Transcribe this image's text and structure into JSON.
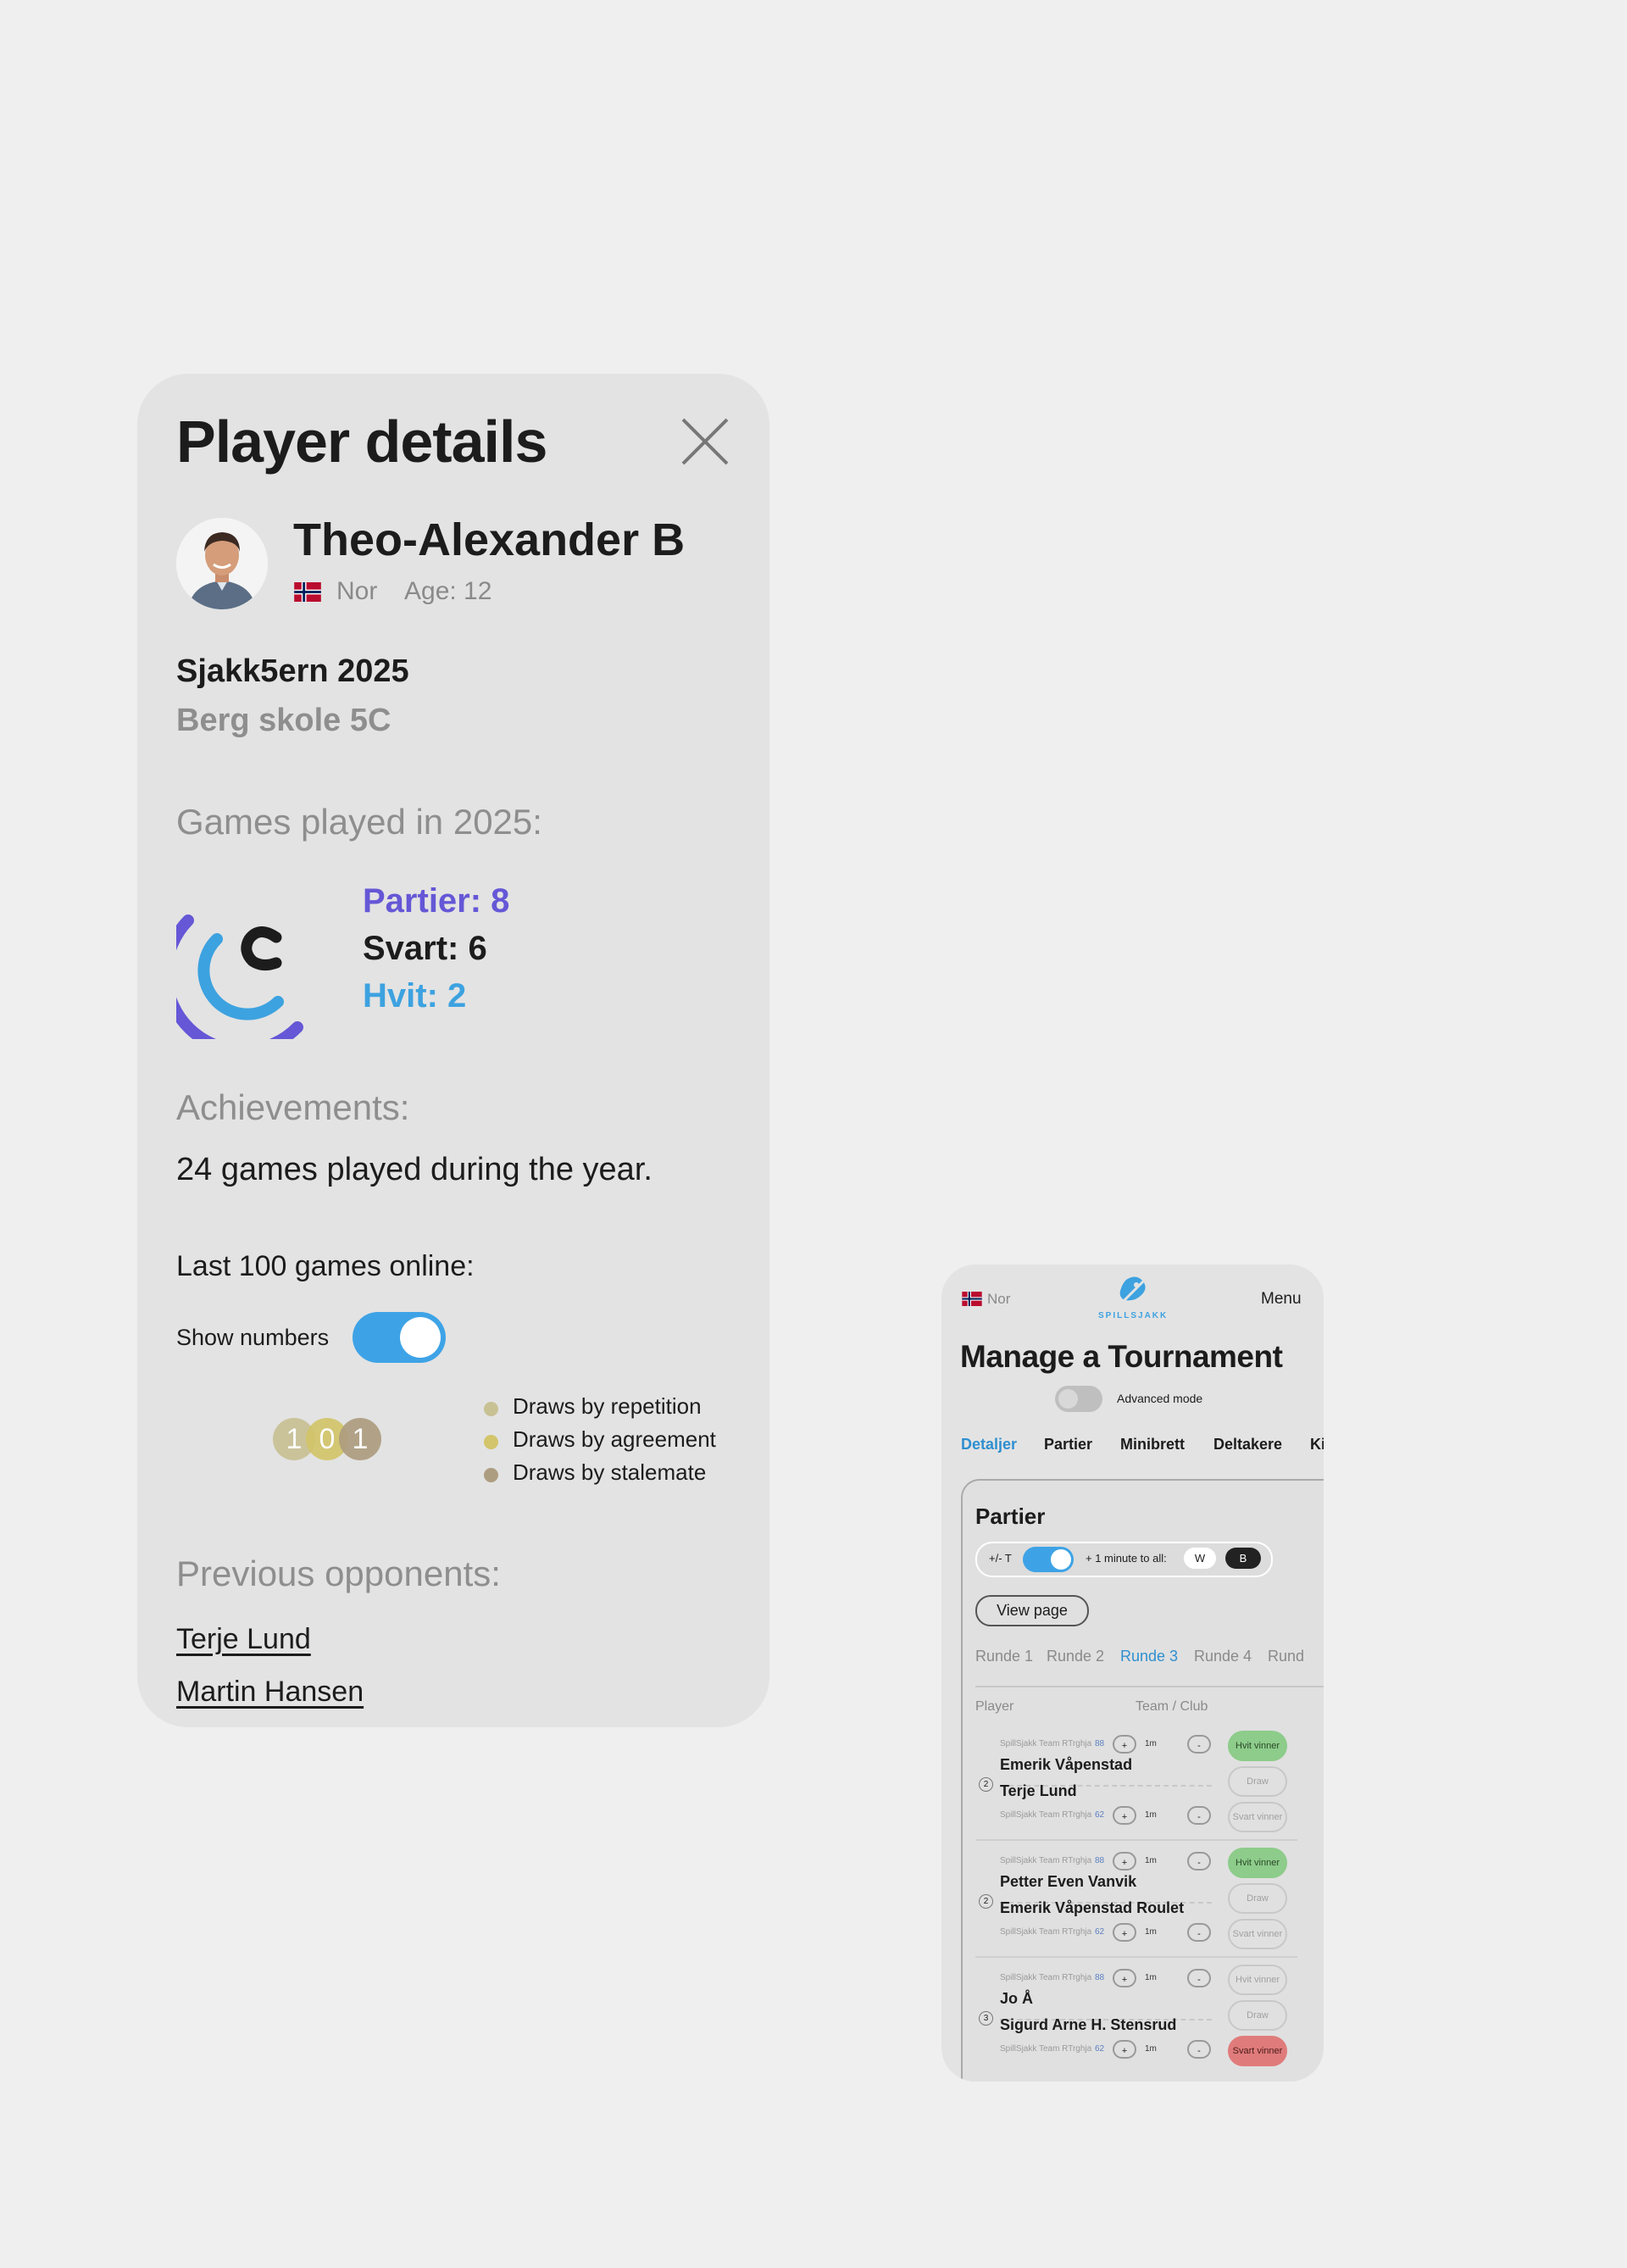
{
  "player_card": {
    "title": "Player details",
    "player": {
      "name": "Theo-Alexander B",
      "country": "Nor",
      "age": "Age: 12"
    },
    "tournament": "Sjakk5ern 2025",
    "school": "Berg skole 5C",
    "games_heading": "Games played in 2025:",
    "stats": {
      "partier": "Partier: 8",
      "svart": "Svart: 6",
      "hvit": "Hvit: 2"
    },
    "achievements_heading": "Achievements:",
    "achievements_text": "24 games played during the year.",
    "last100_label": "Last 100 games online:",
    "show_numbers_label": "Show numbers",
    "show_numbers_on": true,
    "draw_counts": [
      "1",
      "0",
      "1"
    ],
    "legend": [
      {
        "label": "Draws by repetition",
        "color": "#c8c194"
      },
      {
        "label": "Draws by agreement",
        "color": "#d3c56a"
      },
      {
        "label": "Draws by stalemate",
        "color": "#ad9d80"
      }
    ],
    "prev_heading": "Previous opponents:",
    "opponents": [
      "Terje Lund",
      "Martin Hansen"
    ],
    "colors": {
      "partier": "#6557d6",
      "hvit": "#3da2e0",
      "toggle": "#3ea3e6"
    }
  },
  "phone": {
    "country": "Nor",
    "brand": "SPILLSJAKK",
    "menu": "Menu",
    "title": "Manage a Tournament",
    "advanced_mode": "Advanced mode",
    "tabs": [
      "Detaljer",
      "Partier",
      "Minibrett",
      "Deltakere",
      "Ki"
    ],
    "active_tab": "Detaljer",
    "panel_title": "Partier",
    "plus_minus": "+/- T",
    "plus_minute": "+ 1 minute to all:",
    "w": "W",
    "b": "B",
    "view_page": "View page",
    "rounds": [
      "Runde 1",
      "Runde 2",
      "Runde 3",
      "Runde 4",
      "Rund"
    ],
    "active_round": "Runde 3",
    "col_player": "Player",
    "col_team": "Team / Club",
    "matches": [
      {
        "num": "2",
        "white": {
          "team": "SpillSjakk Team RTrghja",
          "rating": "88",
          "name": "Emerik Våpenstad"
        },
        "black": {
          "team": "SpillSjakk Team RTrghja",
          "rating": "62",
          "name": "Terje Lund"
        },
        "result": "white"
      },
      {
        "num": "2",
        "white": {
          "team": "SpillSjakk Team RTrghja",
          "rating": "88",
          "name": "Petter Even Vanvik"
        },
        "black": {
          "team": "SpillSjakk Team RTrghja",
          "rating": "62",
          "name": "Emerik Våpenstad Roulet"
        },
        "result": "white"
      },
      {
        "num": "3",
        "white": {
          "team": "SpillSjakk Team RTrghja",
          "rating": "88",
          "name": "Jo Å"
        },
        "black": {
          "team": "SpillSjakk Team RTrghja",
          "rating": "62",
          "name": "Sigurd Arne H. Stensrud"
        },
        "result": "black"
      }
    ],
    "labels": {
      "plus": "+",
      "one_min": "1m",
      "minus": "-",
      "hvit": "Hvit vinner",
      "draw": "Draw",
      "svart": "Svart vinner"
    }
  }
}
